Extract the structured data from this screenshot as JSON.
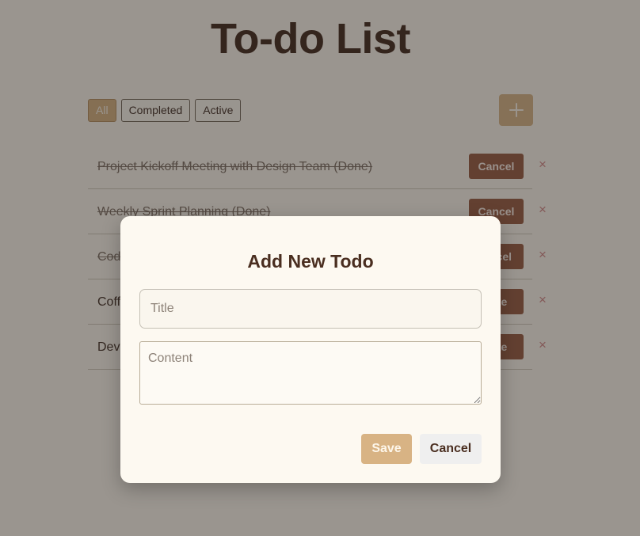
{
  "app": {
    "title": "To-do List"
  },
  "filters": [
    {
      "label": "All",
      "active": true
    },
    {
      "label": "Completed",
      "active": false
    },
    {
      "label": "Active",
      "active": false
    }
  ],
  "add_button": {
    "icon": "plus-icon"
  },
  "todos": [
    {
      "text": "Project Kickoff Meeting with Design Team (Done)",
      "done": true,
      "action": "Cancel"
    },
    {
      "text": "Weekly Sprint Planning (Done)",
      "done": true,
      "action": "Cancel"
    },
    {
      "text": "Cod",
      "done": true,
      "action": "ncel"
    },
    {
      "text": "Coff",
      "done": false,
      "action": "ete"
    },
    {
      "text": "Dev",
      "done": false,
      "action": "ete"
    }
  ],
  "remove_icon": "×",
  "modal": {
    "title": "Add New Todo",
    "title_placeholder": "Title",
    "title_value": "",
    "content_placeholder": "Content",
    "content_value": "",
    "save_label": "Save",
    "cancel_label": "Cancel"
  },
  "colors": {
    "background": "#fdf8ee",
    "accent": "#d8b384",
    "action_button": "#95583e",
    "remove_icon": "#d28585",
    "overlay": "rgba(42,38,36,0.47)"
  }
}
